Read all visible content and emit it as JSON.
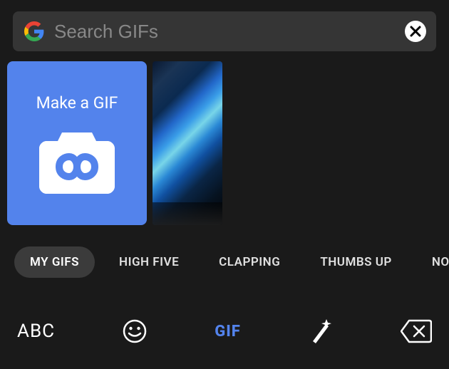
{
  "search": {
    "placeholder": "Search GIFs"
  },
  "makeGif": {
    "label": "Make a GIF"
  },
  "categories": [
    {
      "label": "MY GIFS",
      "active": true
    },
    {
      "label": "HIGH FIVE",
      "active": false
    },
    {
      "label": "CLAPPING",
      "active": false
    },
    {
      "label": "THUMBS UP",
      "active": false
    },
    {
      "label": "NO",
      "active": false
    }
  ],
  "bottomBar": {
    "abc": "ABC",
    "gif": "GIF"
  }
}
